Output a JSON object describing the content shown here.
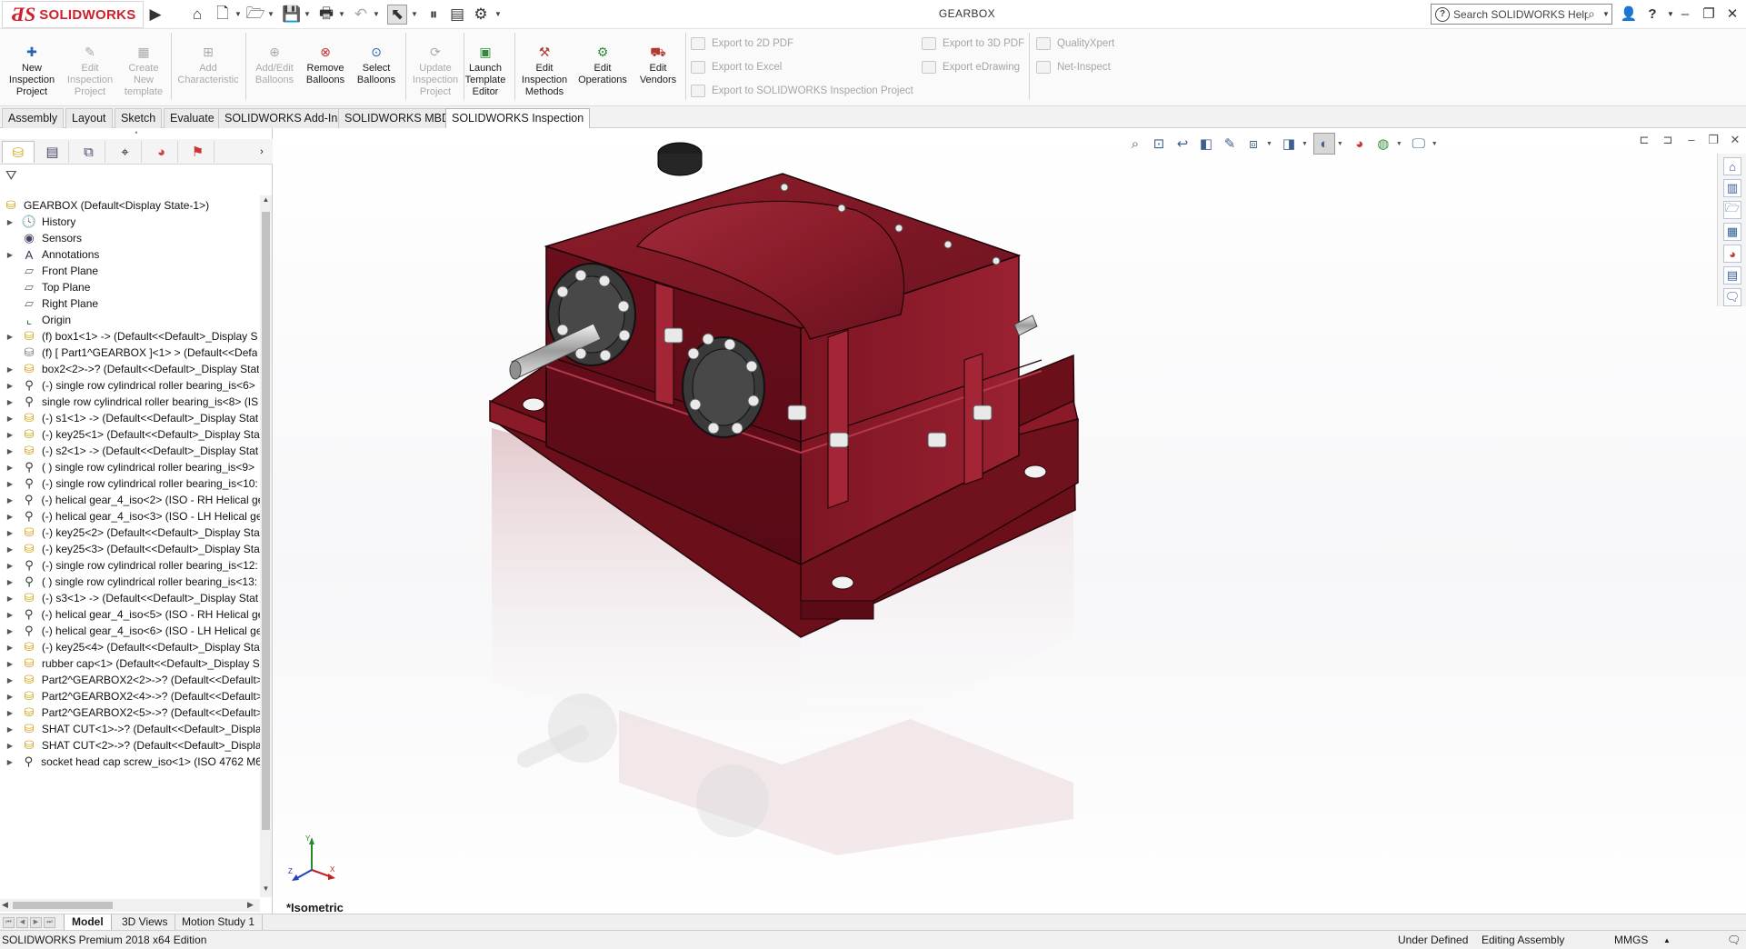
{
  "window": {
    "document_title": "GEARBOX",
    "app_name": "SOLIDWORKS",
    "search_placeholder": "Search SOLIDWORKS Help",
    "help_label": "?"
  },
  "command_manager": {
    "buttons": [
      {
        "label": "New\nInspection\nProject",
        "enabled": true
      },
      {
        "label": "Edit\nInspection\nProject",
        "enabled": false
      },
      {
        "label": "Create\nNew\ntemplate",
        "enabled": false
      },
      {
        "label": "Add\nCharacteristic",
        "enabled": false
      },
      {
        "label": "Add/Edit\nBalloons",
        "enabled": false
      },
      {
        "label": "Remove\nBalloons",
        "enabled": true
      },
      {
        "label": "Select\nBalloons",
        "enabled": true
      },
      {
        "label": "Update\nInspection\nProject",
        "enabled": false
      },
      {
        "label": "Launch\nTemplate\nEditor",
        "enabled": true
      },
      {
        "label": "Edit\nInspection\nMethods",
        "enabled": true
      },
      {
        "label": "Edit\nOperations",
        "enabled": true
      },
      {
        "label": "Edit\nVendors",
        "enabled": true
      }
    ],
    "export_items": [
      "Export to 2D PDF",
      "Export to Excel",
      "Export to SOLIDWORKS Inspection Project",
      "Export to 3D PDF",
      "Export eDrawing",
      "QualityXpert",
      "Net-Inspect"
    ]
  },
  "tabs": [
    {
      "label": "Assembly",
      "active": false
    },
    {
      "label": "Layout",
      "active": false
    },
    {
      "label": "Sketch",
      "active": false
    },
    {
      "label": "Evaluate",
      "active": false
    },
    {
      "label": "SOLIDWORKS Add-Ins",
      "active": false
    },
    {
      "label": "SOLIDWORKS MBD",
      "active": false
    },
    {
      "label": "SOLIDWORKS Inspection",
      "active": true
    }
  ],
  "feature_tree": {
    "root": "GEARBOX  (Default<Display State-1>)",
    "items": [
      {
        "label": "History",
        "icon": "history-icon",
        "expandable": true
      },
      {
        "label": "Sensors",
        "icon": "sensor-icon",
        "expandable": false
      },
      {
        "label": "Annotations",
        "icon": "annotation-icon",
        "expandable": true
      },
      {
        "label": "Front Plane",
        "icon": "plane-icon",
        "expandable": false
      },
      {
        "label": "Top Plane",
        "icon": "plane-icon",
        "expandable": false
      },
      {
        "label": "Right Plane",
        "icon": "plane-icon",
        "expandable": false
      },
      {
        "label": "Origin",
        "icon": "origin-icon",
        "expandable": false
      },
      {
        "label": "(f) box1<1> -> (Default<<Default>_Display S",
        "icon": "part-icon",
        "expandable": true
      },
      {
        "label": "(f) [ Part1^GEARBOX ]<1>  > (Default<<Defa",
        "icon": "virtual-part-icon",
        "expandable": false
      },
      {
        "label": "box2<2>->? (Default<<Default>_Display Stat",
        "icon": "part-icon",
        "expandable": true
      },
      {
        "label": "(-) single row cylindrical roller bearing_is<6>",
        "icon": "subassembly-icon",
        "expandable": true
      },
      {
        "label": "single row cylindrical roller bearing_is<8> (IS",
        "icon": "subassembly-icon",
        "expandable": true
      },
      {
        "label": "(-) s1<1> -> (Default<<Default>_Display Stat",
        "icon": "part-icon",
        "expandable": true
      },
      {
        "label": "(-) key25<1> (Default<<Default>_Display Sta",
        "icon": "part-icon",
        "expandable": true
      },
      {
        "label": "(-) s2<1> -> (Default<<Default>_Display Stat",
        "icon": "part-icon",
        "expandable": true
      },
      {
        "label": "( ) single row cylindrical roller bearing_is<9>",
        "icon": "subassembly-icon",
        "expandable": true
      },
      {
        "label": "(-) single row cylindrical roller bearing_is<10:",
        "icon": "subassembly-icon",
        "expandable": true
      },
      {
        "label": "(-) helical gear_4_iso<2> (ISO - RH Helical ge",
        "icon": "subassembly-icon",
        "expandable": true
      },
      {
        "label": "(-) helical gear_4_iso<3> (ISO - LH Helical ge",
        "icon": "subassembly-icon",
        "expandable": true
      },
      {
        "label": "(-) key25<2> (Default<<Default>_Display Sta",
        "icon": "part-icon",
        "expandable": true
      },
      {
        "label": "(-) key25<3> (Default<<Default>_Display Sta",
        "icon": "part-icon",
        "expandable": true
      },
      {
        "label": "(-) single row cylindrical roller bearing_is<12:",
        "icon": "subassembly-icon",
        "expandable": true
      },
      {
        "label": "( ) single row cylindrical roller bearing_is<13:",
        "icon": "subassembly-icon",
        "expandable": true
      },
      {
        "label": "(-) s3<1> -> (Default<<Default>_Display Stat",
        "icon": "part-icon",
        "expandable": true
      },
      {
        "label": "(-) helical gear_4_iso<5> (ISO - RH Helical ge",
        "icon": "subassembly-icon",
        "expandable": true
      },
      {
        "label": "(-) helical gear_4_iso<6> (ISO - LH Helical ge",
        "icon": "subassembly-icon",
        "expandable": true
      },
      {
        "label": "(-) key25<4> (Default<<Default>_Display Sta",
        "icon": "part-icon",
        "expandable": true
      },
      {
        "label": "rubber cap<1> (Default<<Default>_Display S",
        "icon": "part-icon",
        "expandable": true
      },
      {
        "label": "Part2^GEARBOX2<2>->? (Default<<Default>",
        "icon": "part-icon",
        "expandable": true
      },
      {
        "label": "Part2^GEARBOX2<4>->? (Default<<Default>",
        "icon": "part-icon",
        "expandable": true
      },
      {
        "label": "Part2^GEARBOX2<5>->? (Default<<Default>",
        "icon": "part-icon",
        "expandable": true
      },
      {
        "label": "SHAT CUT<1>->? (Default<<Default>_Displa",
        "icon": "part-icon",
        "expandable": true
      },
      {
        "label": "SHAT CUT<2>->? (Default<<Default>_Displa",
        "icon": "part-icon",
        "expandable": true
      },
      {
        "label": "socket head cap screw_iso<1> (ISO 4762 M6 :",
        "icon": "subassembly-icon",
        "expandable": true
      }
    ]
  },
  "viewport": {
    "view_name": "*Isometric",
    "model_color": "#7a1622",
    "triad_labels": {
      "y": "Y",
      "x": "X",
      "z": "Z"
    }
  },
  "bottom_tabs": [
    {
      "label": "Model",
      "active": true
    },
    {
      "label": "3D Views",
      "active": false
    },
    {
      "label": "Motion Study 1",
      "active": false
    }
  ],
  "status_bar": {
    "edition": "SOLIDWORKS Premium 2018 x64 Edition",
    "definition_state": "Under Defined",
    "editing_state": "Editing Assembly",
    "units": "MMGS"
  }
}
